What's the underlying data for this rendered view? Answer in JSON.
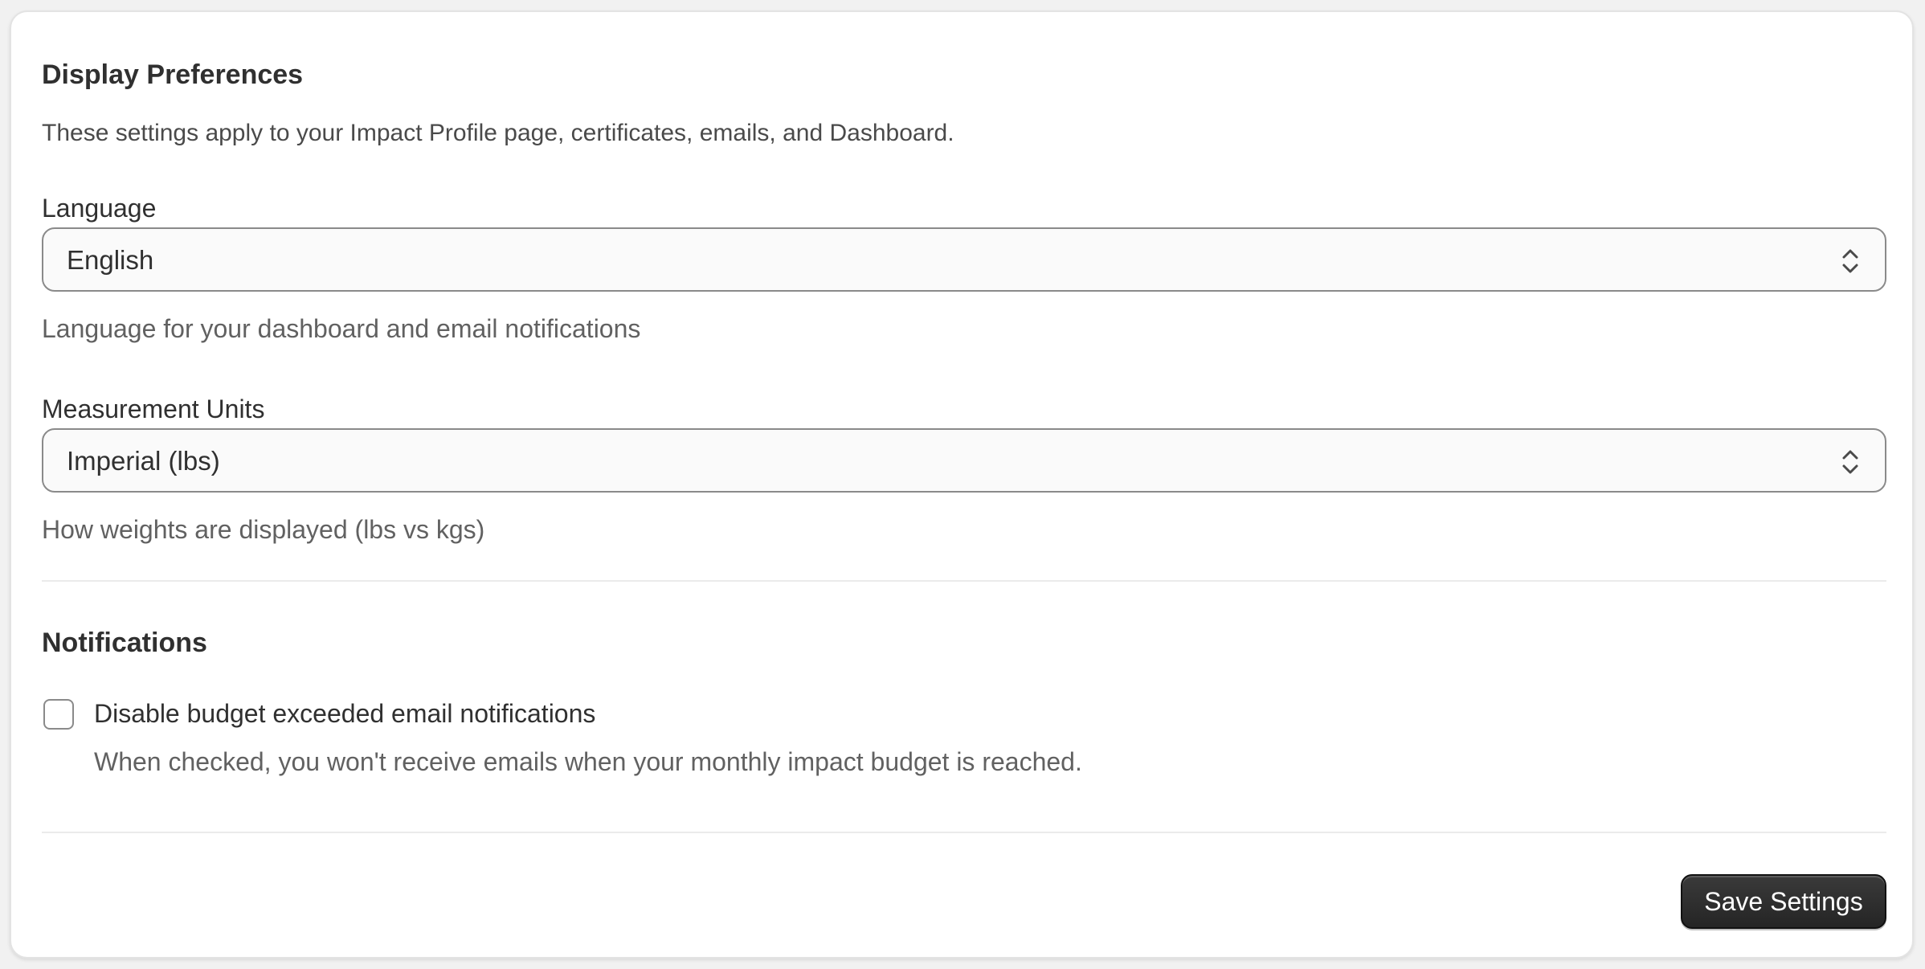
{
  "display_preferences": {
    "title": "Display Preferences",
    "description": "These settings apply to your Impact Profile page, certificates, emails, and Dashboard.",
    "language": {
      "label": "Language",
      "selected": "English",
      "help": "Language for your dashboard and email notifications"
    },
    "units": {
      "label": "Measurement Units",
      "selected": "Imperial (lbs)",
      "help": "How weights are displayed (lbs vs kgs)"
    }
  },
  "notifications": {
    "title": "Notifications",
    "budget_checkbox": {
      "label": "Disable budget exceeded email notifications",
      "checked": false,
      "help": "When checked, you won't receive emails when your monthly impact budget is reached."
    }
  },
  "footer": {
    "save_label": "Save Settings"
  },
  "icons": {
    "select_chevron": "chevron-up-down-icon"
  },
  "colors": {
    "button_bg": "#303030",
    "text": "#303030",
    "muted_text": "#616161",
    "border": "#8a8a8a"
  }
}
